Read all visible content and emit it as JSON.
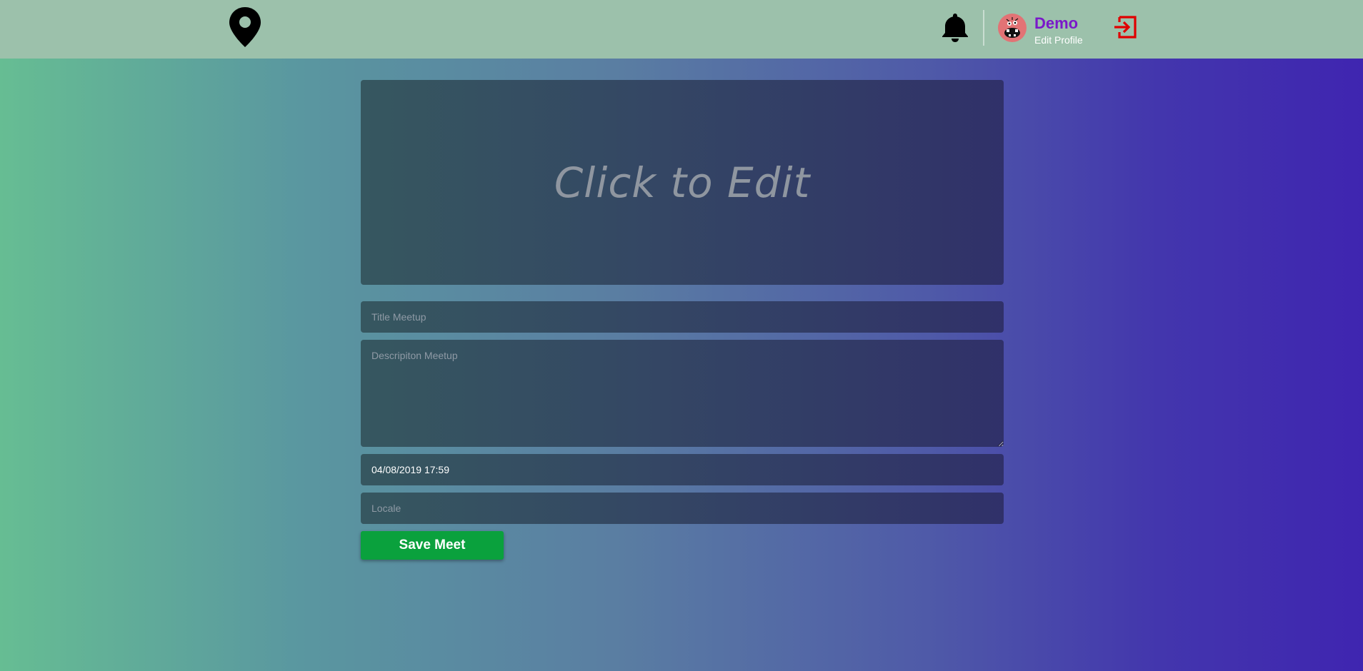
{
  "header": {
    "logo_icon": "map-pin-icon",
    "notification_icon": "bell-icon",
    "user": {
      "name": "Demo",
      "edit_profile_label": "Edit Profile",
      "avatar_color": "#e27375"
    },
    "logout_icon": "logout-icon",
    "logout_color": "#e00000"
  },
  "form": {
    "image_editor_label": "Click to Edit",
    "title_placeholder": "Title Meetup",
    "title_value": "",
    "description_placeholder": "Descripiton Meetup",
    "description_value": "",
    "date_value": "04/08/2019 17:59",
    "locale_placeholder": "Locale",
    "locale_value": "",
    "save_label": "Save Meet"
  },
  "colors": {
    "topbar": "#9cc1ab",
    "gradient_start": "#66bd93",
    "gradient_end": "#3f25b0",
    "save_button": "#0aa13d",
    "username": "#7a18c9"
  }
}
